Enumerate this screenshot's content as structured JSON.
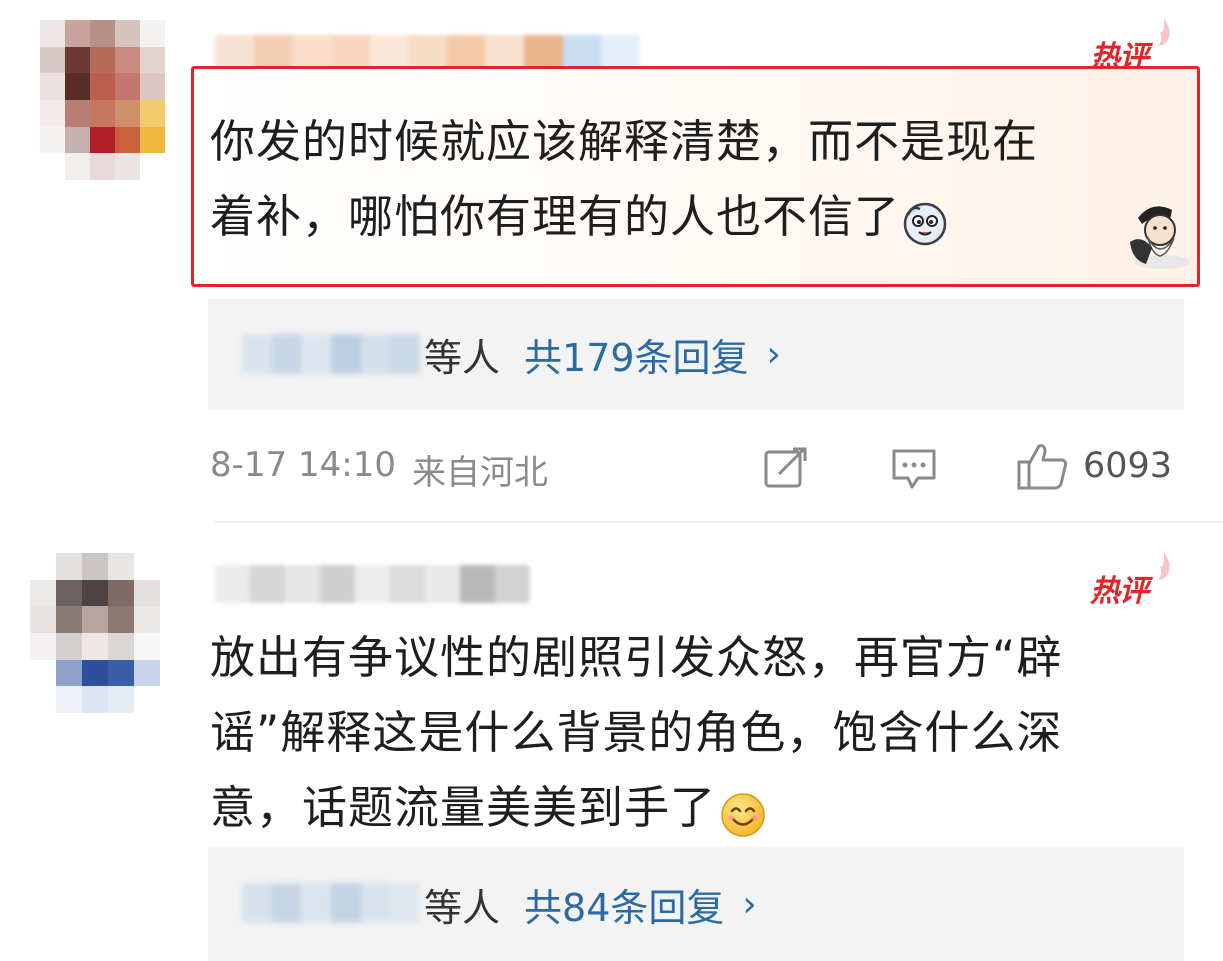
{
  "comments": [
    {
      "badge": "热评",
      "text_line1": "你发的时候就应该解释清楚，而不是现在",
      "text_line2": "着补，哪怕你有理有的人也不信了",
      "emoji": "dog-face-emoji",
      "sticker": "old-man-sticker",
      "replies": {
        "people": "等人",
        "count": "共179条回复",
        "chevron": "›"
      },
      "meta": {
        "timestamp": "8-17 14:10",
        "location": "来自河北"
      },
      "actions": {
        "share_icon": "share-icon",
        "comment_icon": "comment-icon",
        "like_icon": "thumbs-up-icon",
        "like_count": "6093"
      }
    },
    {
      "badge": "热评",
      "text_line1": "放出有争议性的剧照引发众怒，再官方“辟",
      "text_line2": "谣”解释这是什么背景的角色，饱含什么深",
      "text_line3": "意，话题流量美美到手了",
      "emoji": "smiling-face-emoji",
      "replies": {
        "people": "等人",
        "count": "共84条回复",
        "chevron": "›"
      }
    }
  ],
  "colors": {
    "highlight_border": "#e3252b",
    "hot_badge": "#e0262b",
    "reply_link": "#2b6aa3",
    "meta_text": "#8a8a8a"
  }
}
